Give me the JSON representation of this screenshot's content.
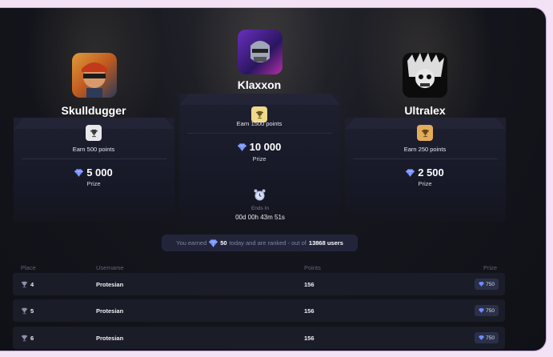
{
  "podium": [
    {
      "rank": 2,
      "name": "Skulldugger",
      "goal": "Earn 500 points",
      "prize": "5 000",
      "prize_label": "Prize",
      "badge_color": "#e8e8ec",
      "icon": "trophy-icon"
    },
    {
      "rank": 1,
      "name": "Klaxxon",
      "goal": "Earn 1500 points",
      "prize": "10 000",
      "prize_label": "Prize",
      "badge_color": "#f0d98a",
      "icon": "trophy-icon"
    },
    {
      "rank": 3,
      "name": "Ultralex",
      "goal": "Earn 250 points",
      "prize": "2 500",
      "prize_label": "Prize",
      "badge_color": "#e2ad5a",
      "icon": "trophy-icon"
    }
  ],
  "timer": {
    "label": "Ends In",
    "value": "00d 00h 43m 51s"
  },
  "summary": {
    "prefix": "You earned",
    "amount": "50",
    "middle": "today and are ranked - out of",
    "total": "13868 users"
  },
  "table": {
    "columns": [
      "Place",
      "Username",
      "Points",
      "Prize"
    ],
    "rows": [
      {
        "place": "4",
        "username": "Protesian",
        "points": "156",
        "prize": "750"
      },
      {
        "place": "5",
        "username": "Protesian",
        "points": "156",
        "prize": "750"
      },
      {
        "place": "6",
        "username": "Protesian",
        "points": "156",
        "prize": "750"
      }
    ]
  },
  "colors": {
    "accent": "#6f8cff",
    "panel": "#1a1c28"
  }
}
